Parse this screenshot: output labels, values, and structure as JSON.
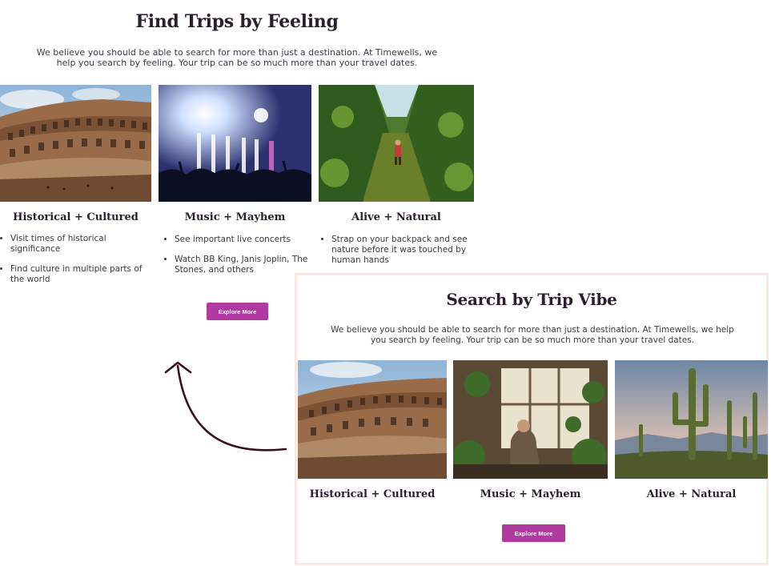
{
  "original_section": {
    "title": "Find Trips by Feeling",
    "intro": "We believe you should be able to search for more than just a destination. At Timewells, we help you search by feeling. Your trip can be so much more than your travel dates.",
    "cards": [
      {
        "title": "Historical + Cultured",
        "image": "colosseum-photo",
        "bullets": [
          "Visit times of historical significance",
          "Find culture in multiple parts of the world"
        ]
      },
      {
        "title": "Music + Mayhem",
        "image": "concert-crowd-photo",
        "bullets": [
          "See important live concerts",
          "Watch BB King, Janis Joplin, The Stones, and others"
        ]
      },
      {
        "title": "Alive + Natural",
        "image": "jungle-hiker-photo",
        "bullets": [
          "Strap on your backpack and see nature before it was touched by human hands"
        ]
      }
    ],
    "button_label": "Explore More"
  },
  "new_section": {
    "title": "Search by Trip Vibe",
    "intro": "We believe you should be able to search for more than just a destination. At Timewells, we help you search by feeling. Your trip can be so much more than your travel dates.",
    "cards": [
      {
        "title": "Historical + Cultured",
        "image": "colosseum-photo"
      },
      {
        "title": "Music + Mayhem",
        "image": "greenhouse-plants-photo"
      },
      {
        "title": "Alive + Natural",
        "image": "desert-cactus-photo"
      }
    ],
    "button_label": "Explore More"
  },
  "annotation": {
    "arrow_icon": "curved-arrow-icon"
  },
  "colors": {
    "button": "#b03aa0",
    "heading": "#2a1f2d",
    "card_border": "#fbe7e2",
    "arrow": "#3b0f1e"
  }
}
